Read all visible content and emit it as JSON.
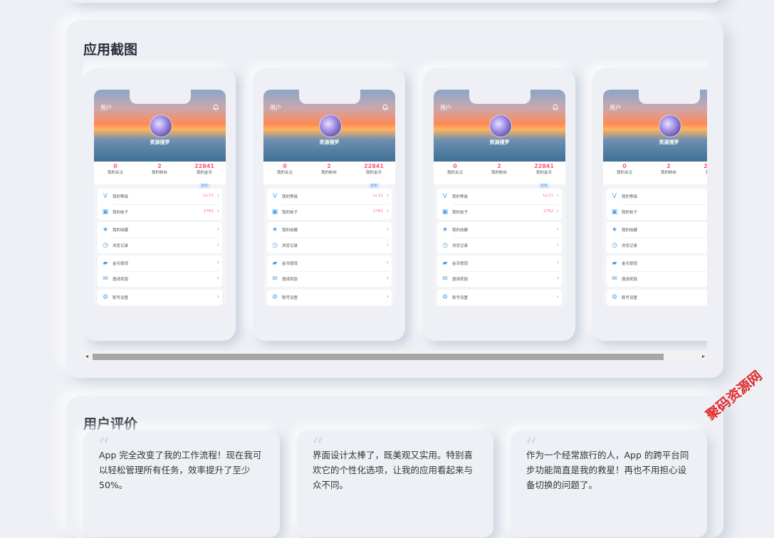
{
  "screenshots_section": {
    "title": "应用截图"
  },
  "phone": {
    "header_label": "用户",
    "nickname": "资源搜罗",
    "stats": [
      {
        "value": "0",
        "label": "我的关注"
      },
      {
        "value": "2",
        "label": "我的粉丝"
      },
      {
        "value": "22841",
        "label": "我的金币",
        "tag": "签到"
      }
    ],
    "groups": [
      [
        {
          "icon": "v-icon",
          "label": "我的等级",
          "value": "Lv.11"
        },
        {
          "icon": "post-icon",
          "label": "我的帖子",
          "value": "2762"
        }
      ],
      [
        {
          "icon": "star-icon",
          "label": "我的收藏",
          "value": ""
        },
        {
          "icon": "clock-icon",
          "label": "浏览记录",
          "value": ""
        }
      ],
      [
        {
          "icon": "wallet-icon",
          "label": "金币提现",
          "value": ""
        },
        {
          "icon": "mail-icon",
          "label": "邀请奖励",
          "value": ""
        }
      ],
      [
        {
          "icon": "gear-icon",
          "label": "账号设置",
          "value": ""
        }
      ]
    ]
  },
  "reviews_section": {
    "title": "用户评价",
    "reviews": [
      {
        "text": "App 完全改变了我的工作流程！现在我可以轻松管理所有任务，效率提升了至少50%。"
      },
      {
        "text": "界面设计太棒了，既美观又实用。特别喜欢它的个性化选项，让我的应用看起来与众不同。"
      },
      {
        "text": "作为一个经常旅行的人，App 的跨平台同步功能简直是我的救星！再也不用担心设备切换的问题了。"
      }
    ]
  },
  "watermark": "聚码资源网"
}
